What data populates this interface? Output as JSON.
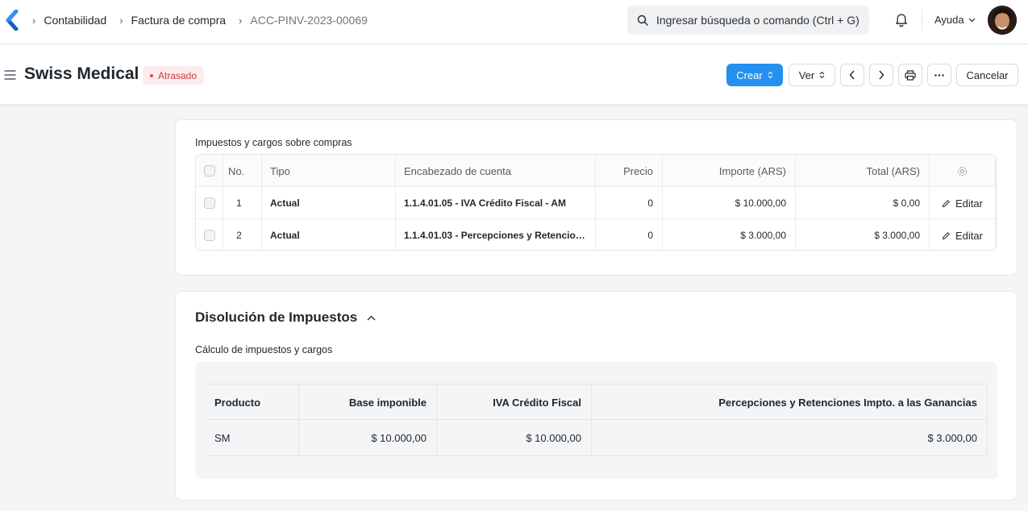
{
  "nav": {
    "breadcrumbs": [
      "Contabilidad",
      "Factura de compra",
      "ACC-PINV-2023-00069"
    ],
    "search_placeholder": "Ingresar búsqueda o comando (Ctrl + G)",
    "help_label": "Ayuda"
  },
  "header": {
    "title": "Swiss Medical",
    "status": "Atrasado",
    "buttons": {
      "create": "Crear",
      "view": "Ver",
      "cancel": "Cancelar"
    }
  },
  "taxes": {
    "label": "Impuestos y cargos sobre compras",
    "columns": [
      "No.",
      "Tipo",
      "Encabezado de cuenta",
      "Precio",
      "Importe (ARS)",
      "Total (ARS)"
    ],
    "rows": [
      {
        "no": "1",
        "type": "Actual",
        "account": "1.1.4.01.05 - IVA Crédito Fiscal - AM",
        "rate": "0",
        "amount": "$ 10.000,00",
        "total": "$ 0,00",
        "action": "Editar"
      },
      {
        "no": "2",
        "type": "Actual",
        "account": "1.1.4.01.03 - Percepciones y Retencio…",
        "rate": "0",
        "amount": "$ 3.000,00",
        "total": "$ 3.000,00",
        "action": "Editar"
      }
    ]
  },
  "breakup": {
    "title": "Disolución de Impuestos",
    "label": "Cálculo de impuestos y cargos",
    "columns": [
      "Producto",
      "Base imponible",
      "IVA Crédito Fiscal",
      "Percepciones y Retenciones Impto. a las Ganancias"
    ],
    "rows": [
      {
        "item": "SM",
        "base": "$ 10.000,00",
        "iva": "$ 10.000,00",
        "perc": "$ 3.000,00"
      }
    ]
  },
  "colors": {
    "primary": "#2490ef",
    "status_red": "#c43d3d",
    "status_bg": "#fdecec"
  }
}
